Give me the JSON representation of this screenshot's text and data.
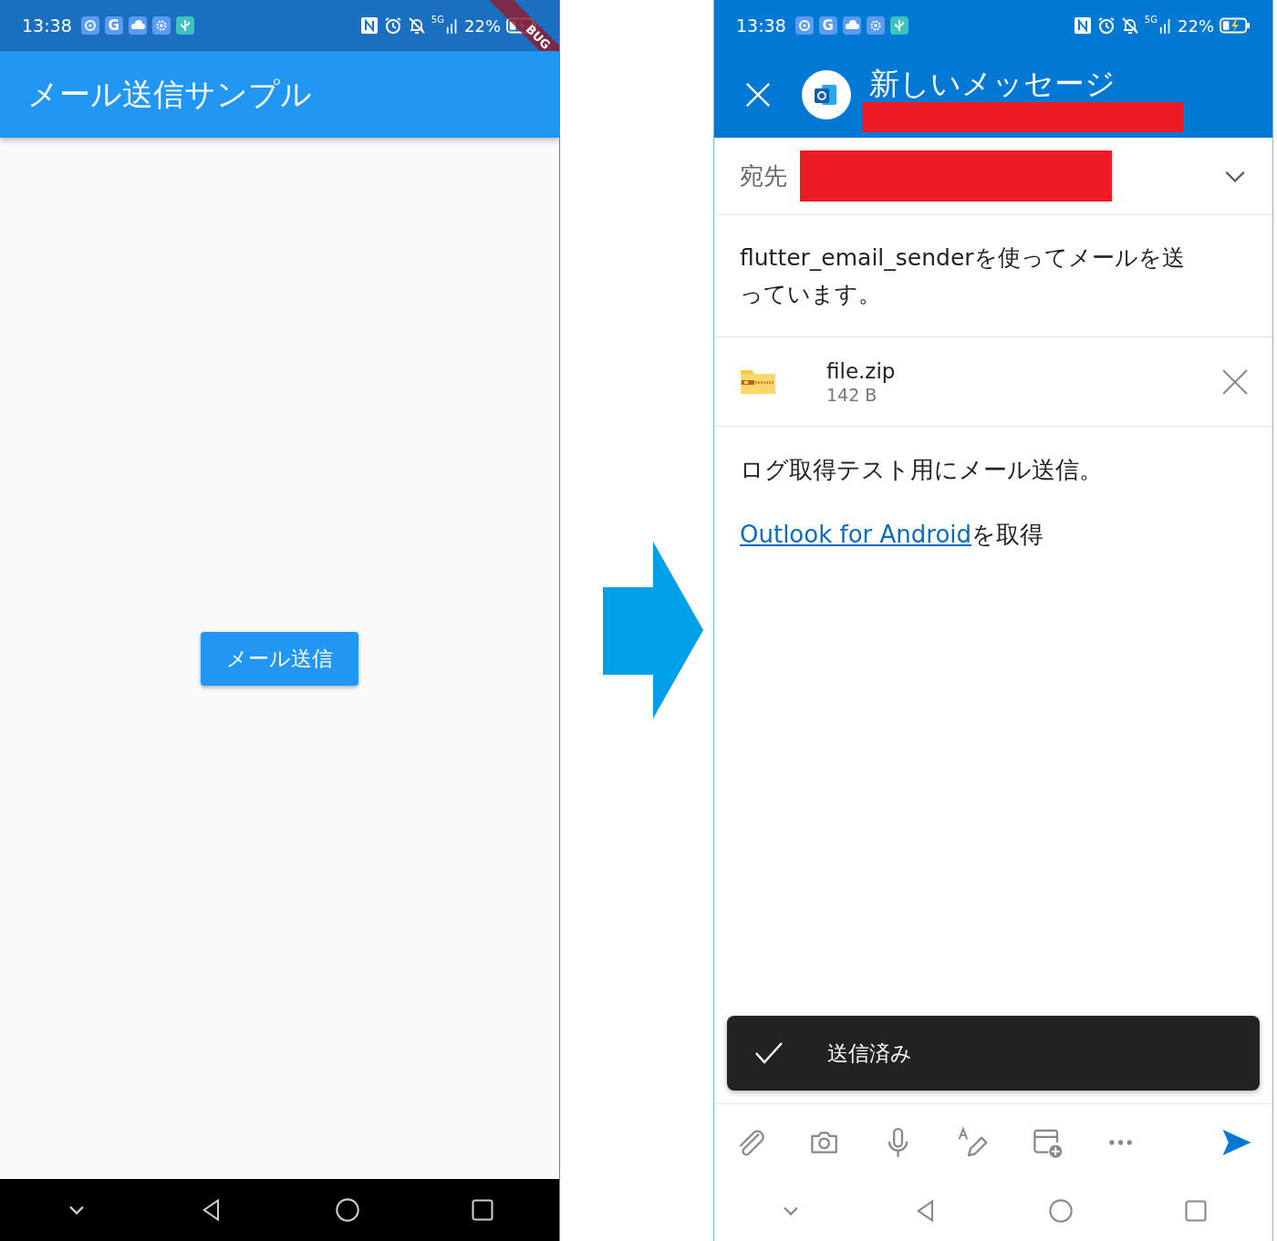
{
  "left_phone": {
    "status_bar": {
      "time": "13:38",
      "app_icon_letter": "G",
      "network": "5G",
      "battery": "22%"
    },
    "debug_banner": "BUG",
    "app_bar": {
      "title": "メール送信サンプル"
    },
    "send_button": "メール送信"
  },
  "right_phone": {
    "status_bar": {
      "time": "13:38",
      "app_icon_letter": "G",
      "network": "5G",
      "battery": "22%"
    },
    "header": {
      "title": "新しいメッセージ"
    },
    "to_label": "宛先",
    "subject": "flutter_email_senderを使ってメールを送っています。",
    "attachment": {
      "name": "file.zip",
      "size": "142 B"
    },
    "body": "ログ取得テスト用にメール送信。",
    "signature": {
      "link": "Outlook for Android",
      "rest": "を取得"
    },
    "snackbar": "送信済み"
  }
}
